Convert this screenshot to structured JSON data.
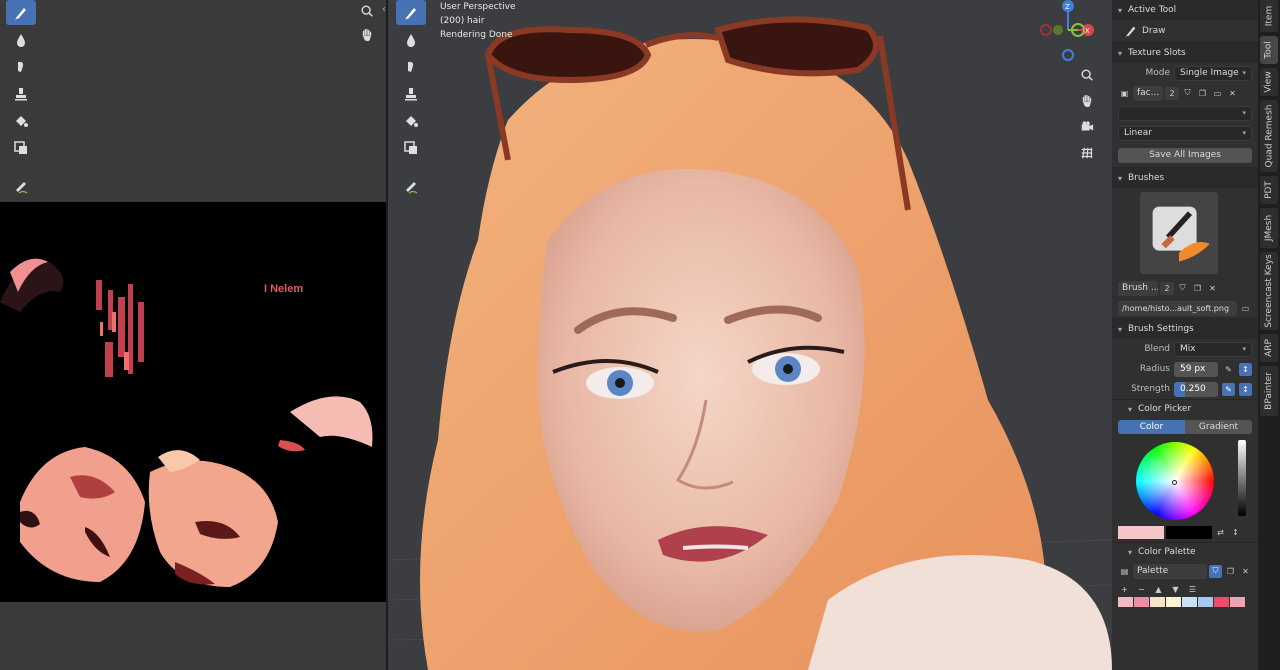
{
  "image_editor": {
    "tools": [
      "brush-icon",
      "drop-icon",
      "smear-icon",
      "stamp-icon",
      "fill-icon",
      "mask-icon",
      "annotate-icon"
    ],
    "texture_text": "I Nelem"
  },
  "viewport": {
    "info": {
      "line1": "User Perspective",
      "line2": "(200) hair",
      "line3": "Rendering Done"
    },
    "tools": [
      "brush-icon",
      "drop-icon",
      "smear-icon",
      "stamp-icon",
      "fill-icon",
      "mask-icon",
      "annotate-icon"
    ],
    "gizmo_axes": {
      "x": "#e0424e",
      "y": "#8ac23b",
      "z": "#3f7fe0"
    },
    "nav_icons": [
      "zoom-icon",
      "hand-icon",
      "camera-icon",
      "grid-icon"
    ]
  },
  "npanel": {
    "active_tool": {
      "header": "Active Tool",
      "name": "Draw"
    },
    "texture_slots": {
      "header": "Texture Slots",
      "mode_label": "Mode",
      "mode_value": "Single Image",
      "image_name": "fac...",
      "image_users": "2",
      "interpolation": "Linear",
      "save_all": "Save All Images"
    },
    "brushes": {
      "header": "Brushes",
      "brush_name": "Brush ...",
      "brush_users": "2",
      "texture_path": "/home/histo...ault_soft.png"
    },
    "brush_settings": {
      "header": "Brush Settings",
      "blend_label": "Blend",
      "blend_value": "Mix",
      "radius_label": "Radius",
      "radius_value": "59 px",
      "strength_label": "Strength",
      "strength_value": "0.250",
      "strength_fraction": 0.25
    },
    "color_picker": {
      "header": "Color Picker",
      "tab_color": "Color",
      "tab_gradient": "Gradient",
      "primary_color": "#f4c6c8",
      "secondary_color": "#000000"
    },
    "color_palette": {
      "header": "Color Palette",
      "palette_name": "Palette",
      "swatches": [
        "#f4b8c2",
        "#f18ca6",
        "#f6e3c8",
        "#fdf6d0",
        "#c9e3f4",
        "#a8c8f0",
        "#e94f6a",
        "#f0a0b0"
      ]
    }
  },
  "vertical_tabs": [
    "Item",
    "Tool",
    "View",
    "Quad Remesh",
    "PDT",
    "JMesh",
    "Screencast Keys",
    "ARP",
    "BPainter"
  ],
  "active_vertical_tab": "Tool"
}
